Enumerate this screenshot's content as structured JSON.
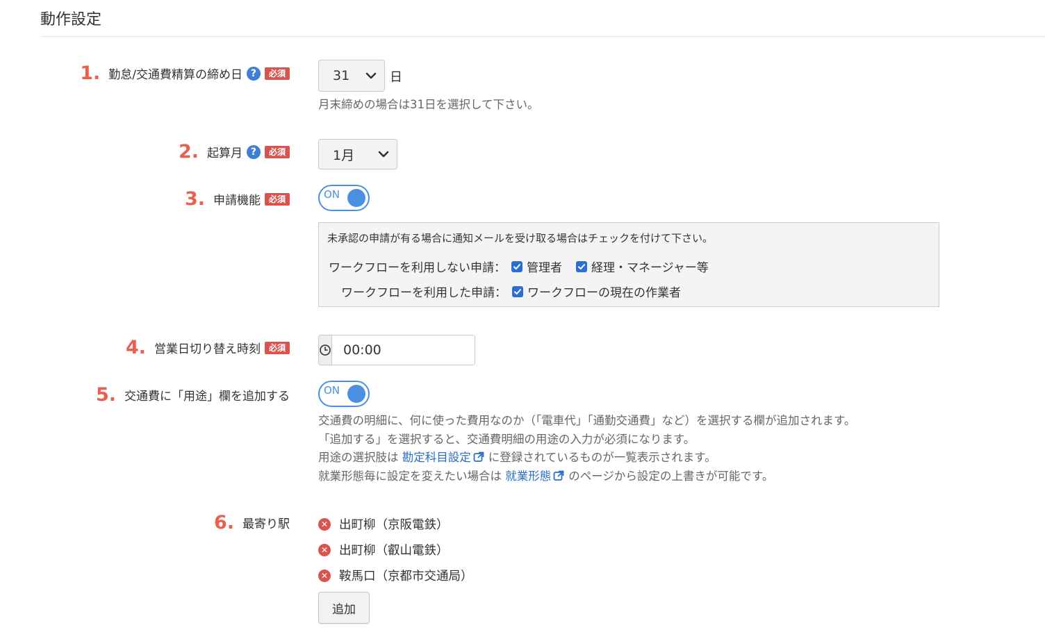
{
  "section": {
    "title": "動作設定"
  },
  "items": {
    "closing_day": {
      "num": "1.",
      "label": "勤怠/交通費精算の締め日",
      "help": "?",
      "required": "必須",
      "select_value": "31",
      "unit": "日",
      "hint": "月末締めの場合は31日を選択して下さい。"
    },
    "start_month": {
      "num": "2.",
      "label": "起算月",
      "help": "?",
      "required": "必須",
      "select_value": "1月"
    },
    "request_function": {
      "num": "3.",
      "label": "申請機能",
      "required": "必須",
      "toggle_label": "ON",
      "toggle_on": true,
      "notify_text": "未承認の申請が有る場合に通知メールを受け取る場合はチェックを付けて下さい。",
      "no_workflow_label": "ワークフローを利用しない申請：",
      "no_workflow_options": [
        {
          "label": "管理者",
          "checked": true
        },
        {
          "label": "経理・マネージャー等",
          "checked": true
        }
      ],
      "workflow_label": "ワークフローを利用した申請：",
      "workflow_options": [
        {
          "label": "ワークフローの現在の作業者",
          "checked": true
        }
      ]
    },
    "business_day_switch": {
      "num": "4.",
      "label": "営業日切り替え時刻",
      "required": "必須",
      "time_value": "00:00"
    },
    "purpose_column": {
      "num": "5.",
      "label": "交通費に「用途」欄を追加する",
      "toggle_label": "ON",
      "toggle_on": true,
      "hint_line1": "交通費の明細に、何に使った費用なのか（「電車代」「通勤交通費」など）を選択する欄が追加されます。",
      "hint_line2": "「追加する」を選択すると、交通費明細の用途の入力が必須になります。",
      "hint_line3_pre": "用途の選択肢は",
      "hint_line3_link": "勘定科目設定",
      "hint_line3_post": "に登録されているものが一覧表示されます。",
      "hint_line4_pre": "就業形態毎に設定を変えたい場合は",
      "hint_line4_link": "就業形態",
      "hint_line4_post": "のページから設定の上書きが可能です。"
    },
    "nearest_station": {
      "num": "6.",
      "label": "最寄り駅",
      "stations": [
        "出町柳（京阪電鉄）",
        "出町柳（叡山電鉄）",
        "鞍馬口（京都市交通局）"
      ],
      "add_label": "追加"
    }
  },
  "icons": {
    "help": "question-circle-icon",
    "chevron": "chevron-down-icon",
    "clock": "clock-icon",
    "external": "external-link-icon",
    "remove": "remove-circle-icon",
    "checkbox": "checkbox-checked-icon"
  },
  "colors": {
    "accent_number": "#e8614f",
    "required_badge": "#d9534f",
    "help_icon": "#3f7fd3",
    "toggle": "#4a90e2",
    "link": "#2a6fc9",
    "checkbox": "#2a6fd1"
  }
}
